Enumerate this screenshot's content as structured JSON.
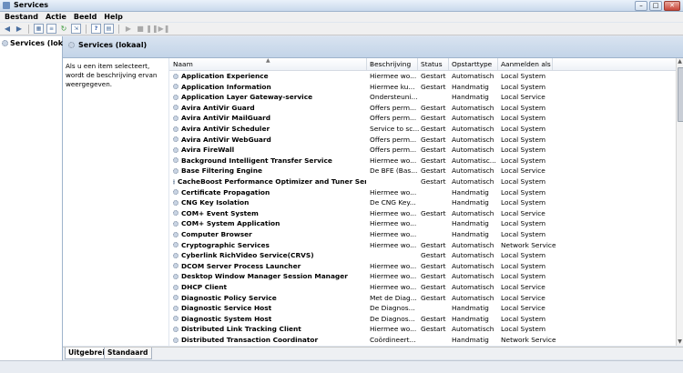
{
  "window": {
    "title": "Services"
  },
  "menu": [
    "Bestand",
    "Actie",
    "Beeld",
    "Help"
  ],
  "tree": {
    "item": "Services (lokaal)"
  },
  "right_header": {
    "title": "Services (lokaal)"
  },
  "description_text": "Als u een item selecteert, wordt de beschrijving ervan weergegeven.",
  "columns": {
    "name": "Naam",
    "desc": "Beschrijving",
    "status": "Status",
    "start": "Opstarttype",
    "logon": "Aanmelden als"
  },
  "services": [
    {
      "name": "Application Experience",
      "desc": "Hiermee wo...",
      "status": "Gestart",
      "start": "Automatisch",
      "logon": "Local System"
    },
    {
      "name": "Application Information",
      "desc": "Hiermee ku...",
      "status": "Gestart",
      "start": "Handmatig",
      "logon": "Local System"
    },
    {
      "name": "Application Layer Gateway-service",
      "desc": "Ondersteuni...",
      "status": "",
      "start": "Handmatig",
      "logon": "Local Service"
    },
    {
      "name": "Avira AntiVir Guard",
      "desc": "Offers perm...",
      "status": "Gestart",
      "start": "Automatisch",
      "logon": "Local System"
    },
    {
      "name": "Avira AntiVir MailGuard",
      "desc": "Offers perm...",
      "status": "Gestart",
      "start": "Automatisch",
      "logon": "Local System"
    },
    {
      "name": "Avira AntiVir Scheduler",
      "desc": "Service to sc...",
      "status": "Gestart",
      "start": "Automatisch",
      "logon": "Local System"
    },
    {
      "name": "Avira AntiVir WebGuard",
      "desc": "Offers perm...",
      "status": "Gestart",
      "start": "Automatisch",
      "logon": "Local System"
    },
    {
      "name": "Avira FireWall",
      "desc": "Offers perm...",
      "status": "Gestart",
      "start": "Automatisch",
      "logon": "Local System"
    },
    {
      "name": "Background Intelligent Transfer Service",
      "desc": "Hiermee wo...",
      "status": "Gestart",
      "start": "Automatisc...",
      "logon": "Local System"
    },
    {
      "name": "Base Filtering Engine",
      "desc": "De BFE (Bas...",
      "status": "Gestart",
      "start": "Automatisch",
      "logon": "Local Service"
    },
    {
      "name": "CacheBoost Performance Optimizer and Tuner Service",
      "desc": "",
      "status": "Gestart",
      "start": "Automatisch",
      "logon": "Local System"
    },
    {
      "name": "Certificate Propagation",
      "desc": "Hiermee wo...",
      "status": "",
      "start": "Handmatig",
      "logon": "Local System"
    },
    {
      "name": "CNG Key Isolation",
      "desc": "De CNG Key...",
      "status": "",
      "start": "Handmatig",
      "logon": "Local System"
    },
    {
      "name": "COM+ Event System",
      "desc": "Hiermee wo...",
      "status": "Gestart",
      "start": "Automatisch",
      "logon": "Local Service"
    },
    {
      "name": "COM+ System Application",
      "desc": "Hiermee wo...",
      "status": "",
      "start": "Handmatig",
      "logon": "Local System"
    },
    {
      "name": "Computer Browser",
      "desc": "Hiermee wo...",
      "status": "",
      "start": "Handmatig",
      "logon": "Local System"
    },
    {
      "name": "Cryptographic Services",
      "desc": "Hiermee wo...",
      "status": "Gestart",
      "start": "Automatisch",
      "logon": "Network Service"
    },
    {
      "name": "Cyberlink RichVideo Service(CRVS)",
      "desc": "",
      "status": "Gestart",
      "start": "Automatisch",
      "logon": "Local System"
    },
    {
      "name": "DCOM Server Process Launcher",
      "desc": "Hiermee wo...",
      "status": "Gestart",
      "start": "Automatisch",
      "logon": "Local System"
    },
    {
      "name": "Desktop Window Manager Session Manager",
      "desc": "Hiermee wo...",
      "status": "Gestart",
      "start": "Automatisch",
      "logon": "Local System"
    },
    {
      "name": "DHCP Client",
      "desc": "Hiermee wo...",
      "status": "Gestart",
      "start": "Automatisch",
      "logon": "Local Service"
    },
    {
      "name": "Diagnostic Policy Service",
      "desc": "Met de Diag...",
      "status": "Gestart",
      "start": "Automatisch",
      "logon": "Local Service"
    },
    {
      "name": "Diagnostic Service Host",
      "desc": "De Diagnos...",
      "status": "",
      "start": "Handmatig",
      "logon": "Local Service"
    },
    {
      "name": "Diagnostic System Host",
      "desc": "De Diagnos...",
      "status": "Gestart",
      "start": "Handmatig",
      "logon": "Local System"
    },
    {
      "name": "Distributed Link Tracking Client",
      "desc": "Hiermee wo...",
      "status": "Gestart",
      "start": "Automatisch",
      "logon": "Local System"
    },
    {
      "name": "Distributed Transaction Coordinator",
      "desc": "Coördineert...",
      "status": "",
      "start": "Handmatig",
      "logon": "Network Service"
    }
  ],
  "tabs": [
    "Uitgebreid",
    "Standaard"
  ]
}
